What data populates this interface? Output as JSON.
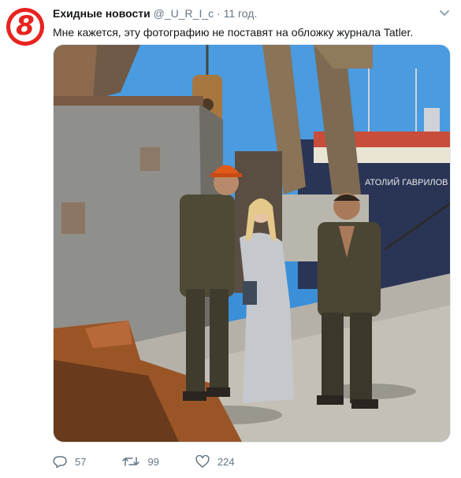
{
  "tweet": {
    "display_name": "Ехидные новости",
    "handle": "@_U_R_I_c",
    "separator": "·",
    "time": "11 год.",
    "text": "Мне кажется, эту фотографию не поставят на обложку журнала Tatler.",
    "avatar_label": "8"
  },
  "photo": {
    "ship_name": "АТОЛИЙ ГАВРИЛОВ"
  },
  "actions": {
    "replies": "57",
    "retweets": "99",
    "likes": "224"
  },
  "colors": {
    "avatar": "#e8231f",
    "muted": "#657786",
    "text": "#14171a",
    "sky": "#3b8fd8"
  }
}
